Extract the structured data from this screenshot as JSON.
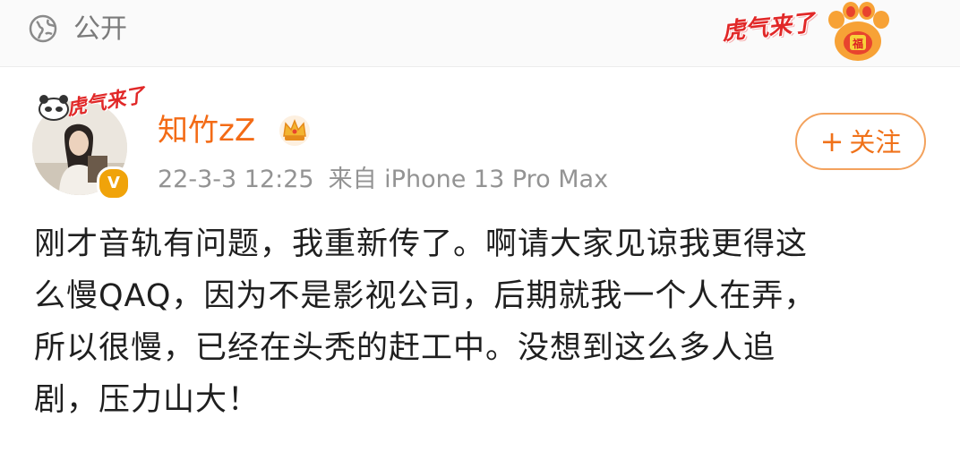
{
  "header": {
    "visibility_label": "公开",
    "visibility_icon": "globe-icon",
    "festival_badge_text": "虎气来了"
  },
  "post": {
    "author": {
      "name": "知竹zZ",
      "crown_icon": "crown-icon",
      "verified_icon": "verified-badge-icon",
      "avatar_frame_text": "虎气来了"
    },
    "timestamp": "22-3-3 12:25",
    "source": "来自 iPhone 13 Pro Max",
    "follow_label": "关注",
    "follow_plus": "+",
    "lines": [
      "刚才音轨有问题，我重新传了。啊请大家见谅我更得这",
      "么慢QAQ，因为不是影视公司，后期就我一个人在弄，",
      "所以很慢，已经在头秃的赶工中。没想到这么多人追",
      "剧，压力山大！"
    ]
  },
  "colors": {
    "username": "#f36b16",
    "follow": "#f0721a",
    "meta": "#939393",
    "text": "#1f1f1f"
  }
}
